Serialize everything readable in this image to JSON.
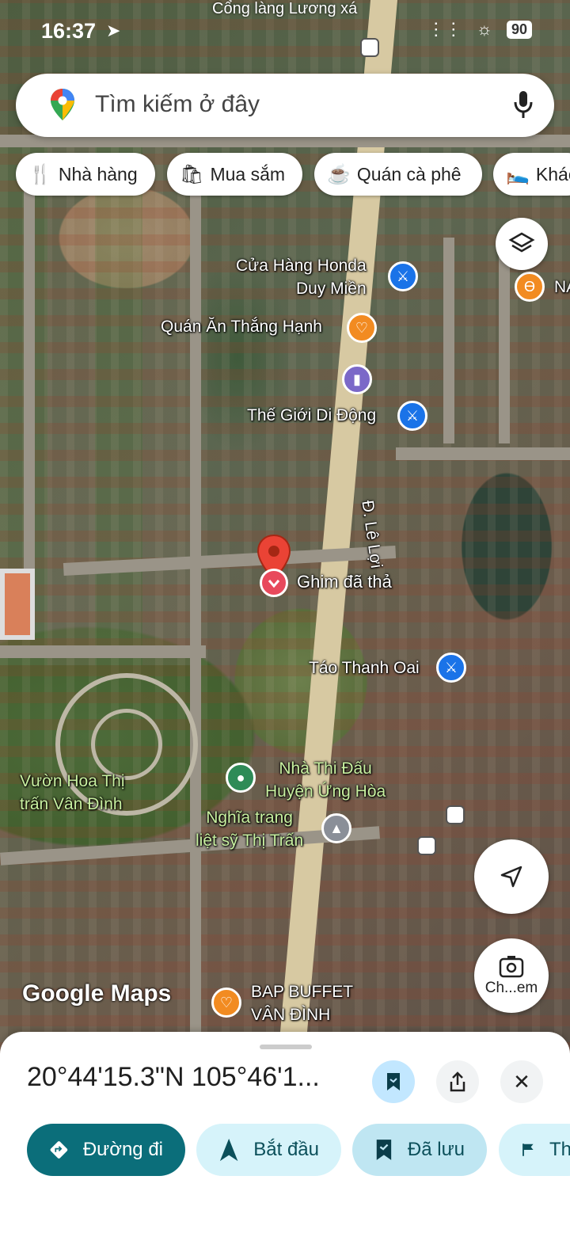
{
  "status_bar": {
    "time": "16:37",
    "battery": "90"
  },
  "search": {
    "placeholder": "Tìm kiếm ở đây"
  },
  "chips": [
    {
      "label": "Nhà hàng",
      "icon": "restaurant-icon"
    },
    {
      "label": "Mua sắm",
      "icon": "shopping-bag-icon"
    },
    {
      "label": "Quán cà phê",
      "icon": "coffee-icon"
    },
    {
      "label": "Khác",
      "icon": "hotel-bed-icon"
    }
  ],
  "map": {
    "top_label": "Cổng làng Lương xá",
    "labels": {
      "honda": "Cửa Hàng Honda\nDuy Miền",
      "quan_an": "Quán Ăn Thắng Hạnh",
      "tgdd": "Thế Giới Di Động",
      "road": "Đ. Lê Lợi",
      "dropped_pin": "Ghim đã thả",
      "tao": "Táo Thanh Oai",
      "nha_thi_dau": "Nhà Thi Đấu\nHuyện Ứng Hòa",
      "vuon_hoa": "Vườn Hoa Thị\ntrấn Vân Đình",
      "nghia_trang": "Nghĩa trang\nliệt sỹ Thị Trấn",
      "bap_buffet": "BAP BUFFET\nVÂN ĐÌNH",
      "na": "NA"
    },
    "watermark": "Google Maps",
    "lens_label": "Ch...em"
  },
  "sheet": {
    "coordinates": "20°44'15.3\"N 105°46'1...",
    "actions": {
      "directions": "Đường đi",
      "start": "Bắt đầu",
      "saved": "Đã lưu",
      "more": "Th"
    }
  },
  "colors": {
    "accent": "#0b6e7a",
    "pin_red": "#e8495c",
    "poi_blue": "#1a73e8",
    "poi_orange": "#f28b21"
  }
}
